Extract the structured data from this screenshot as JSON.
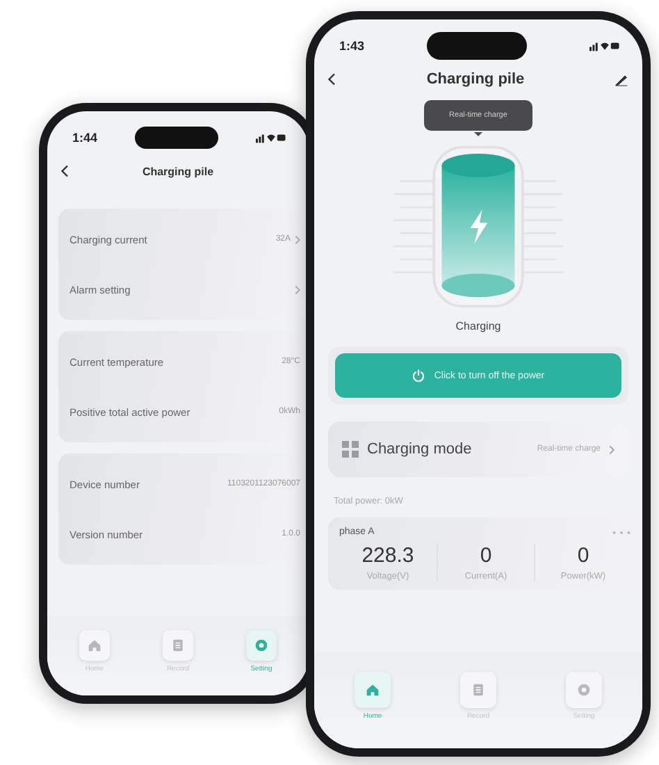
{
  "back_phone": {
    "time": "1:44",
    "title": "Charging pile",
    "groups": [
      [
        {
          "label": "Charging current",
          "value": "32A",
          "arrow": true
        },
        {
          "label": "Alarm setting",
          "arrow": true
        }
      ],
      [
        {
          "label": "Current temperature",
          "value": "28°C",
          "arrow": false
        },
        {
          "label": "Positive total active power",
          "value": "0kWh",
          "arrow": false
        }
      ],
      [
        {
          "label": "Device number",
          "value": "1103201123076007",
          "arrow": false
        },
        {
          "label": "Version number",
          "value": "1.0.0",
          "arrow": false
        }
      ]
    ],
    "tabs": [
      {
        "kind": "home",
        "label": "Home",
        "selected": false
      },
      {
        "kind": "record",
        "label": "Record",
        "selected": false
      },
      {
        "kind": "setting",
        "label": "Setting",
        "selected": true
      }
    ]
  },
  "front_phone": {
    "time": "1:43",
    "title": "Charging pile",
    "tooltip": "Real-time charge",
    "status": "Charging",
    "power_button": "Click to turn off the power",
    "mode": {
      "label": "Charging mode",
      "value": "Real-time charge"
    },
    "total_power": "Total power:  0kW",
    "phase": {
      "name": "phase A",
      "metrics": [
        {
          "value": "228.3",
          "label": "Voltage(V)"
        },
        {
          "value": "0",
          "label": "Current(A)"
        },
        {
          "value": "0",
          "label": "Power(kW)"
        }
      ]
    },
    "tabs": [
      {
        "kind": "home",
        "label": "Home",
        "selected": true
      },
      {
        "kind": "record",
        "label": "Record",
        "selected": false
      },
      {
        "kind": "setting",
        "label": "Setting",
        "selected": false
      }
    ]
  }
}
